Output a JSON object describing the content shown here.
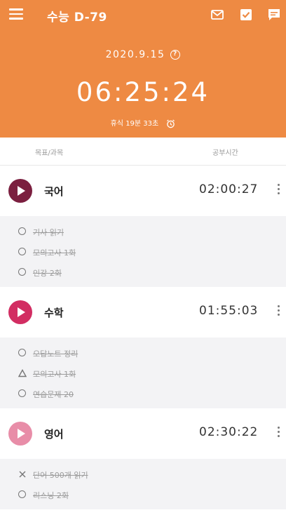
{
  "header": {
    "title": "수능 D-79",
    "date": "2020.9.15",
    "clock": "06:25:24",
    "rest_label": "휴식",
    "rest_time": "19분 33초",
    "bg_color": "#ee8a43"
  },
  "columns": {
    "left": "목표/과목",
    "right": "공부시간"
  },
  "subjects": [
    {
      "name": "국어",
      "time": "02:00:27",
      "color": "#7b1f3f",
      "tasks": [
        {
          "mark": "circle",
          "label": "기사 읽기"
        },
        {
          "mark": "circle",
          "label": "모의고사 1회"
        },
        {
          "mark": "circle",
          "label": "인강 2회"
        }
      ]
    },
    {
      "name": "수학",
      "time": "01:55:03",
      "color": "#d22d62",
      "tasks": [
        {
          "mark": "circle",
          "label": "오답노트 정리"
        },
        {
          "mark": "triangle",
          "label": "모의고사 1회"
        },
        {
          "mark": "circle",
          "label": "연습문제 20"
        }
      ]
    },
    {
      "name": "영어",
      "time": "02:30:22",
      "color": "#e88da8",
      "tasks": [
        {
          "mark": "x",
          "label": "단어 500개 읽기"
        },
        {
          "mark": "circle",
          "label": "리스닝 2회"
        }
      ]
    }
  ],
  "icons": {
    "menu": "menu-icon",
    "mail": "mail-icon",
    "check": "checkbox-icon",
    "chat": "chat-icon",
    "help": "help-icon",
    "alarm": "alarm-icon",
    "play": "play-icon",
    "more": "more-vertical-icon"
  }
}
